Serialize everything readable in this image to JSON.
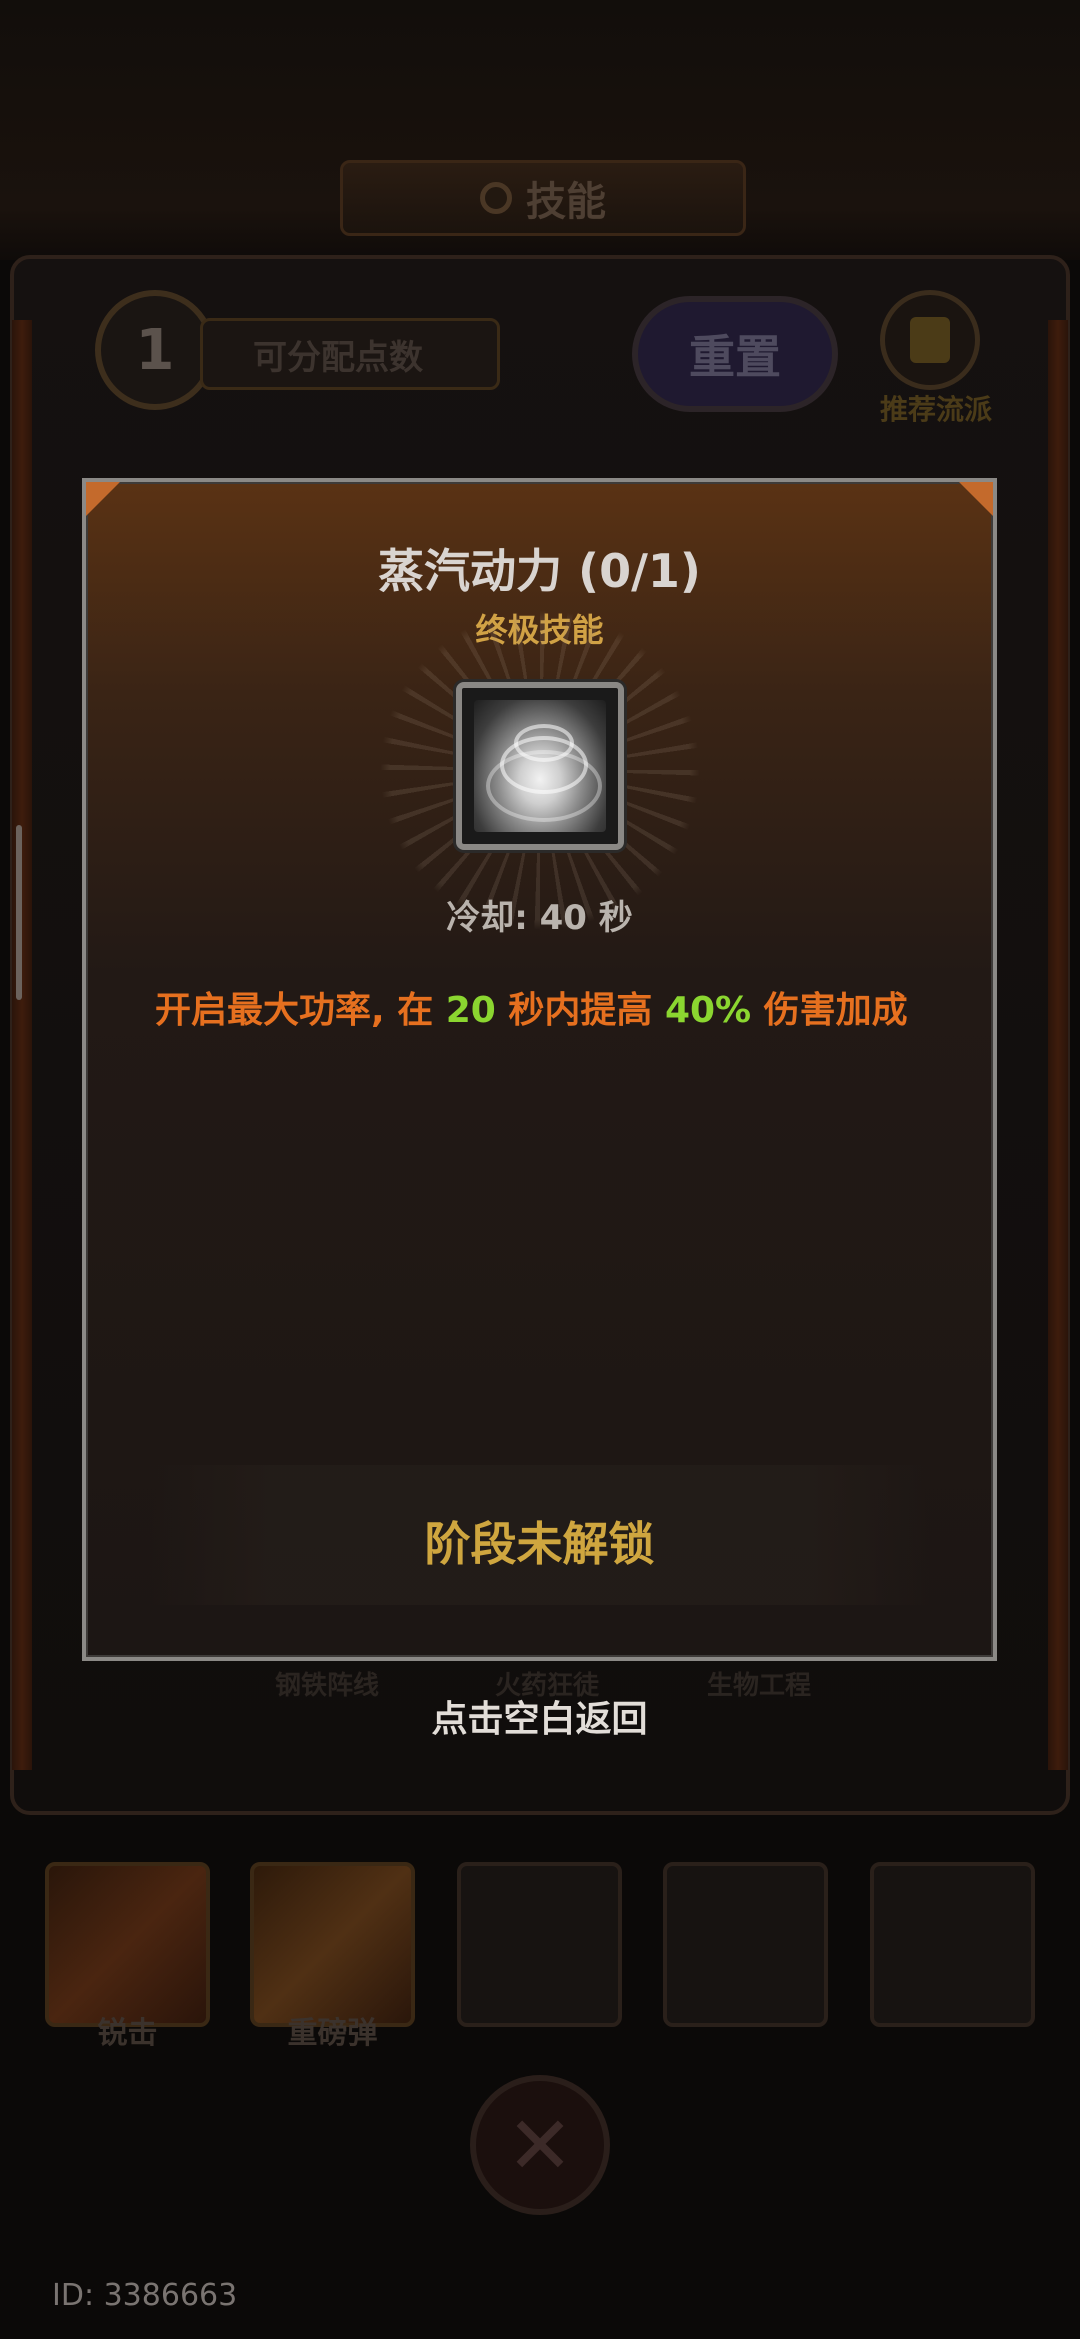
{
  "screen": {
    "title": "技能",
    "available_points": "1",
    "available_points_label": "可分配点数",
    "reset_label": "重置",
    "recommend_label": "推荐流派",
    "bottom_tabs": [
      "钢铁阵线",
      "火药狂徒",
      "生物工程"
    ],
    "equipped_skills": [
      {
        "name": "锐击",
        "state": "filled"
      },
      {
        "name": "重磅弹",
        "state": "filled"
      },
      {
        "name": "",
        "state": "empty"
      },
      {
        "name": "",
        "state": "empty"
      },
      {
        "name": "",
        "state": "empty"
      }
    ],
    "user_id": "ID: 3386663"
  },
  "popup": {
    "skill_name": "蒸汽动力 (0/1)",
    "skill_type": "终极技能",
    "icon": "steam-swirl-icon",
    "cooldown": "冷却: 40 秒",
    "description": {
      "part1": "开启最大功率, 在 ",
      "duration": "20",
      "part2": " 秒内提高 ",
      "bonus": "40%",
      "part3": " 伤害加成"
    },
    "lock_status": "阶段未解锁",
    "dismiss_hint": "点击空白返回"
  },
  "colors": {
    "description": "#e6701f",
    "highlight": "#8bd630",
    "lock_text": "#cfa63f",
    "skill_type": "#d1a245"
  }
}
